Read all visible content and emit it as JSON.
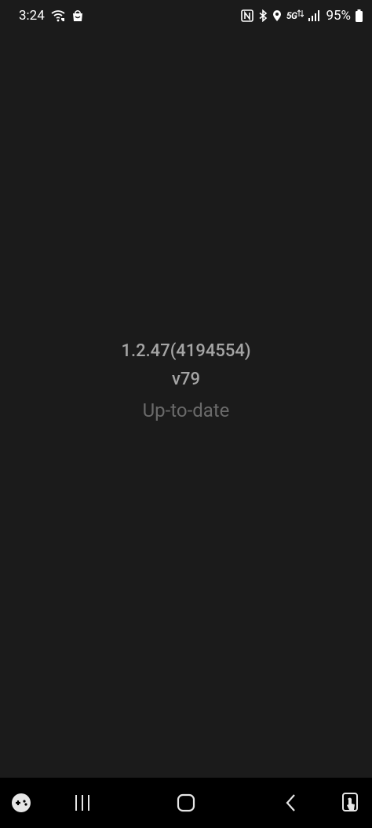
{
  "status_bar": {
    "time": "3:24",
    "network_label": "5G",
    "battery_percent": "95%",
    "left_icons": [
      "wifi-calling-icon",
      "shopping-bag-icon"
    ],
    "right_icons": [
      "nfc-icon",
      "bluetooth-icon",
      "location-icon",
      "5g-icon",
      "signal-icon",
      "battery-icon"
    ]
  },
  "content": {
    "version": "1.2.47(4194554)",
    "build": "v79",
    "update_status": "Up-to-date"
  },
  "nav_bar": {
    "items": [
      "game-launcher-icon",
      "recent-apps-icon",
      "home-icon",
      "back-icon",
      "accessibility-icon"
    ]
  }
}
